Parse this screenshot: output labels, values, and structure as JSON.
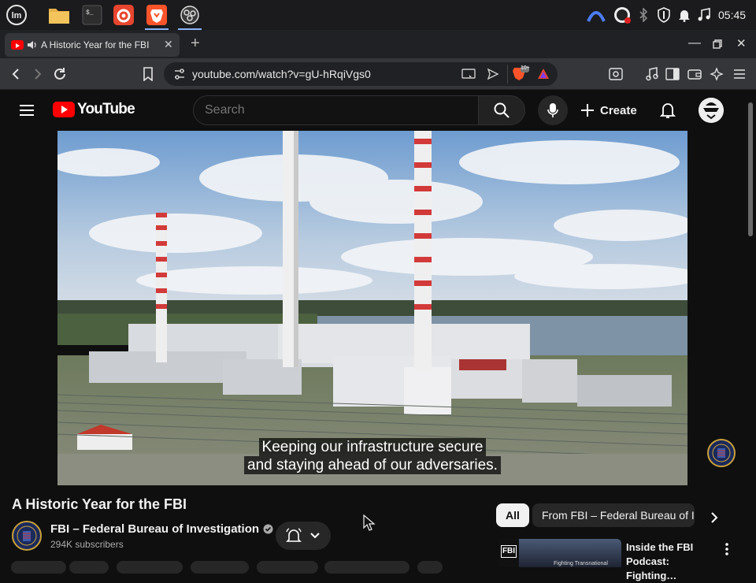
{
  "taskbar": {
    "clock": "05:45",
    "apps": [
      "mint-menu-icon",
      "files-folder-icon",
      "terminal-icon",
      "firefox-icon",
      "brave-browser-icon",
      "obs-studio-icon"
    ],
    "tray": [
      "cloud-icon",
      "obs-tray-icon",
      "bluetooth-icon",
      "shield-icon",
      "notifications-icon",
      "music-icon"
    ]
  },
  "browser": {
    "tab_title": "A Historic Year for the FBI",
    "new_tab": "+",
    "url": "youtube.com/watch?v=gU-hRqiVgs0",
    "brave_badge": "10+"
  },
  "youtube": {
    "logo_text": "YouTube",
    "search_placeholder": "Search",
    "create_label": "Create",
    "captions": [
      "Keeping our infrastructure secure",
      "and staying ahead of our adversaries."
    ],
    "video_title": "A Historic Year for the FBI",
    "channel_name": "FBI – Federal Bureau of Investigation",
    "subscribers": "294K subscribers",
    "chips": [
      "All",
      "From FBI – Federal Bureau of Investigation"
    ],
    "rec_title": "Inside the FBI Podcast: Fighting…",
    "rec_thumb_text": "FBI",
    "rec_thumb_sub": "Fighting Transnational"
  },
  "colors": {
    "brand_red": "#ff0000",
    "taskbar": "#1b1b1d",
    "page_bg": "#0f0f0f"
  }
}
